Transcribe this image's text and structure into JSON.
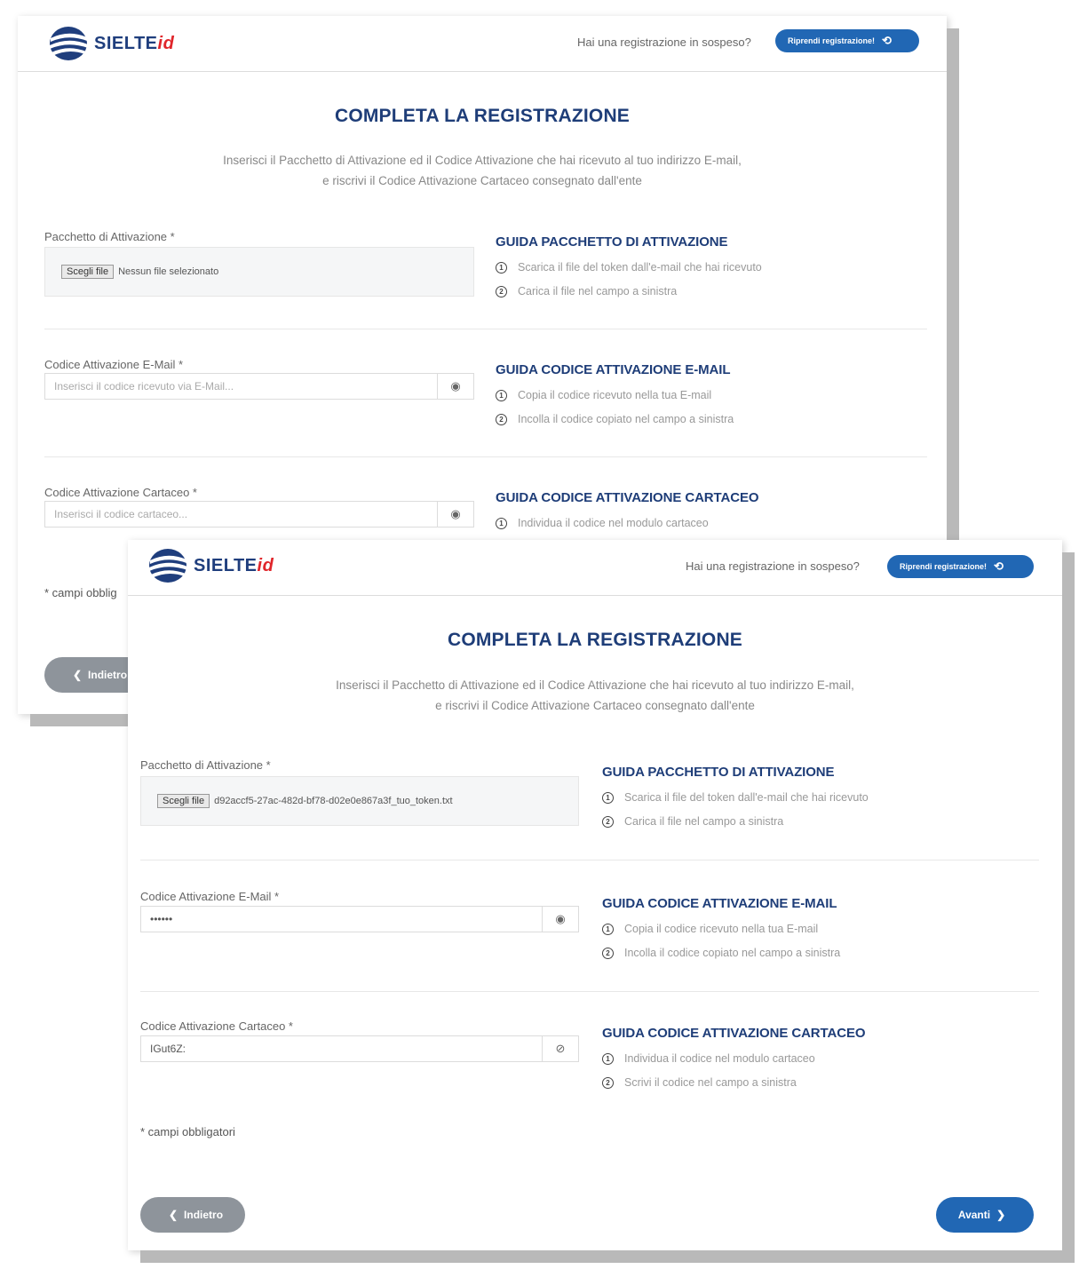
{
  "brand": {
    "name": "SIELTE",
    "suffix": "id"
  },
  "header": {
    "pending_text": "Hai una registrazione in sospeso?",
    "resume_label": "Riprendi registrazione!"
  },
  "page": {
    "title": "COMPLETA LA REGISTRAZIONE",
    "subtitle_line1": "Inserisci il Pacchetto di Attivazione ed il Codice Attivazione che hai ricevuto al tuo indirizzo E-mail,",
    "subtitle_line2": "e riscrivi il Codice Attivazione Cartaceo consegnato dall'ente"
  },
  "fields": {
    "package_label": "Pacchetto di Attivazione *",
    "choose_file_label": "Scegli file",
    "email_code_label": "Codice Attivazione E-Mail *",
    "email_code_placeholder": "Inserisci il codice ricevuto via E-Mail...",
    "paper_code_label": "Codice Attivazione Cartaceo *",
    "paper_code_placeholder": "Inserisci il codice cartaceo..."
  },
  "guides": {
    "package": {
      "title": "GUIDA PACCHETTO DI ATTIVAZIONE",
      "steps": [
        "Scarica il file del token dall'e-mail che hai ricevuto",
        "Carica il file nel campo a sinistra"
      ]
    },
    "email": {
      "title": "GUIDA CODICE ATTIVAZIONE E-MAIL",
      "steps": [
        "Copia il codice ricevuto nella tua E-mail",
        "Incolla il codice copiato nel campo a sinistra"
      ]
    },
    "paper": {
      "title": "GUIDA CODICE ATTIVAZIONE CARTACEO",
      "steps": [
        "Individua il codice nel modulo cartaceo",
        "Scrivi il codice nel campo a sinistra"
      ]
    }
  },
  "back_screen": {
    "file_name": "Nessun file selezionato",
    "required_note": "* campi obblig",
    "back_label": "Indietro"
  },
  "front_screen": {
    "file_name": "d92accf5-27ac-482d-bf78-d02e0e867a3f_tuo_token.txt",
    "email_code_value": "••••••",
    "paper_code_value": "IGut6Z:",
    "required_note": "* campi obbligatori",
    "back_label": "Indietro",
    "next_label": "Avanti"
  },
  "icons": {
    "eye": "eye-icon",
    "eye_slash": "eye-slash-icon",
    "chevron_left": "chevron-left-icon",
    "chevron_right": "chevron-right-icon",
    "resume": "undo-icon",
    "step": "numbered-circle-icon"
  },
  "colors": {
    "brand_blue": "#2167b4",
    "title_navy": "#1e3d78",
    "back_grey": "#8e949b",
    "brand_red": "#e0262b"
  }
}
